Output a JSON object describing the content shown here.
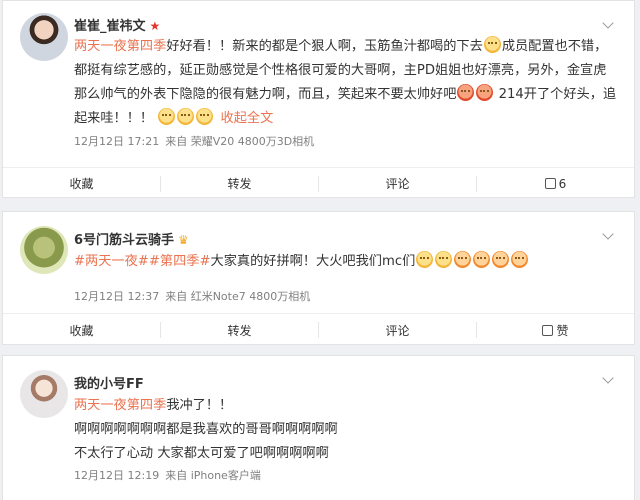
{
  "posts": [
    {
      "name": "崔崔_崔祎文",
      "badge": "★",
      "text": {
        "tag": "两天一夜第四季",
        "body": "好好看！！新来的都是个狠人啊，玉筋鱼汁都喝的下去",
        "body2": "成员配置也不错，都挺有综艺感的，延正勋感觉是个性格很可爱的大哥啊，主PD姐姐也好漂亮，另外，金宣虎那么帅气的外表下隐隐的很有魅力啊，而且，笑起来不要太帅好吧",
        "body3": "214开了个好头，追起来哇！！！",
        "collapse": "收起全文",
        "collapse_icon": "chevron-up-icon"
      },
      "meta": {
        "date": "12月12日 17:21",
        "source": "来自 荣耀V20 4800万3D相机"
      },
      "actions": {
        "favorite": "收藏",
        "repost": "转发",
        "comment": "评论",
        "like": "6"
      }
    },
    {
      "name": "6号门筋斗云骑手",
      "badge": "♛",
      "text": {
        "tag1": "#两天一夜#",
        "tag2": "#第四季#",
        "body": "大家真的好拼啊！大火吧我们mc们"
      },
      "meta": {
        "date": "12月12日 12:37",
        "source": "来自 红米Note7 4800万相机"
      },
      "actions": {
        "favorite": "收藏",
        "repost": "转发",
        "comment": "评论",
        "like": "赞"
      }
    },
    {
      "name": "我的小号FF",
      "text": {
        "tag": "两天一夜第四季",
        "body": "我冲了！！",
        "line2": "啊啊啊啊啊啊啊都是我喜欢的哥哥啊啊啊啊啊",
        "line3": "不太行了心动 大家都太可爱了吧啊啊啊啊啊"
      },
      "meta": {
        "date": "12月12日 12:19",
        "source": "来自 iPhone客户端"
      }
    }
  ],
  "icons": {
    "caret": "chevron-down-icon",
    "like": "thumb-up-icon",
    "emoji": "emoji-icon"
  }
}
